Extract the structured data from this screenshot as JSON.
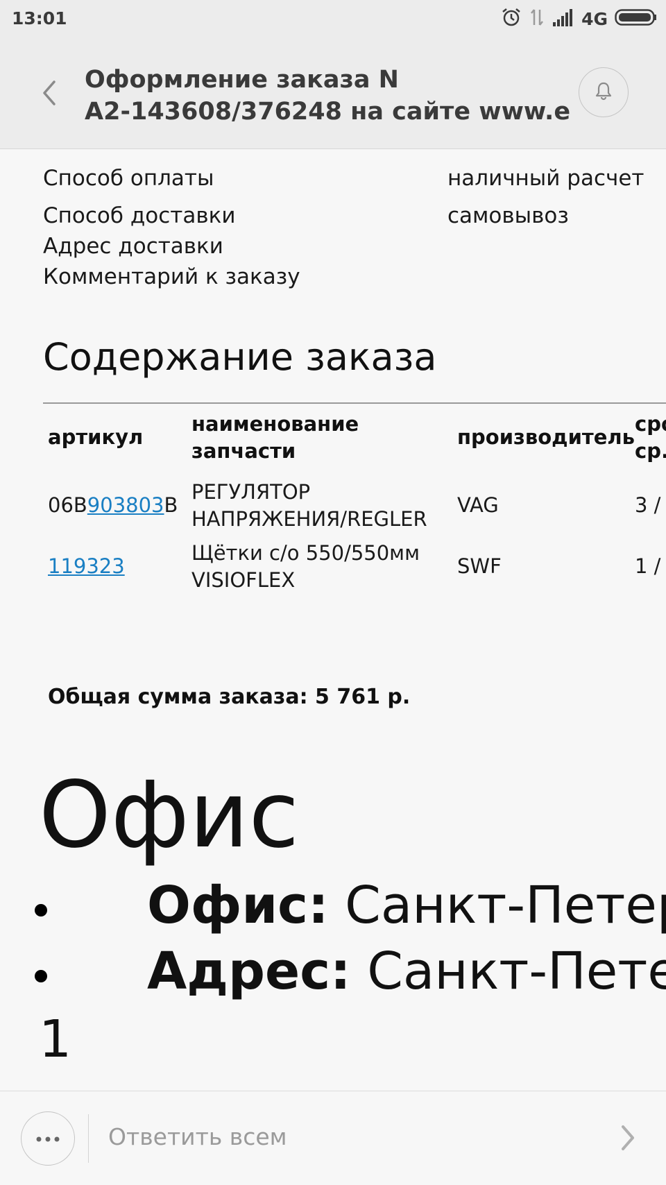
{
  "status": {
    "time": "13:01",
    "network": "4G"
  },
  "header": {
    "title_line1": "Оформление заказа N",
    "title_line2": "A2-143608/376248 на сайте www.e…"
  },
  "details": [
    {
      "label": "Способ оплаты",
      "value": "наличный расчет"
    },
    {
      "label": "Способ доставки",
      "value": "самовывоз"
    },
    {
      "label": "Адрес доставки",
      "value": ""
    },
    {
      "label": "Комментарий к заказу",
      "value": ""
    }
  ],
  "section_title": "Содержание заказа",
  "table": {
    "headers": {
      "article": "артикул",
      "name_line1": "наименование",
      "name_line2": "запчасти",
      "maker": "производитель",
      "term_line1": "сро",
      "term_line2": "ср."
    },
    "rows": [
      {
        "article_prefix": "06B",
        "article_link": "903803",
        "article_suffix": "B",
        "name_line1": "РЕГУЛЯТОР",
        "name_line2": "НАПРЯЖЕНИЯ/REGLER",
        "maker": "VAG",
        "term": "3 /"
      },
      {
        "article_prefix": "",
        "article_link": "119323",
        "article_suffix": "",
        "name_line1": "Щётки с/о 550/550мм",
        "name_line2": "VISIOFLEX",
        "maker": "SWF",
        "term": "1 /"
      }
    ]
  },
  "total": "Общая сумма заказа: 5 761 р.",
  "office": {
    "title": "Офис",
    "items": [
      {
        "label": "Офис:",
        "value": "Санкт-Петер"
      },
      {
        "label": "Адрес:",
        "value": "Санкт-Пете"
      }
    ],
    "footer_number": "1"
  },
  "bottom": {
    "reply_placeholder": "Ответить всем"
  },
  "colors": {
    "link": "#1a7fc3",
    "bar_bg": "#ececec",
    "page_bg": "#f7f7f7"
  }
}
